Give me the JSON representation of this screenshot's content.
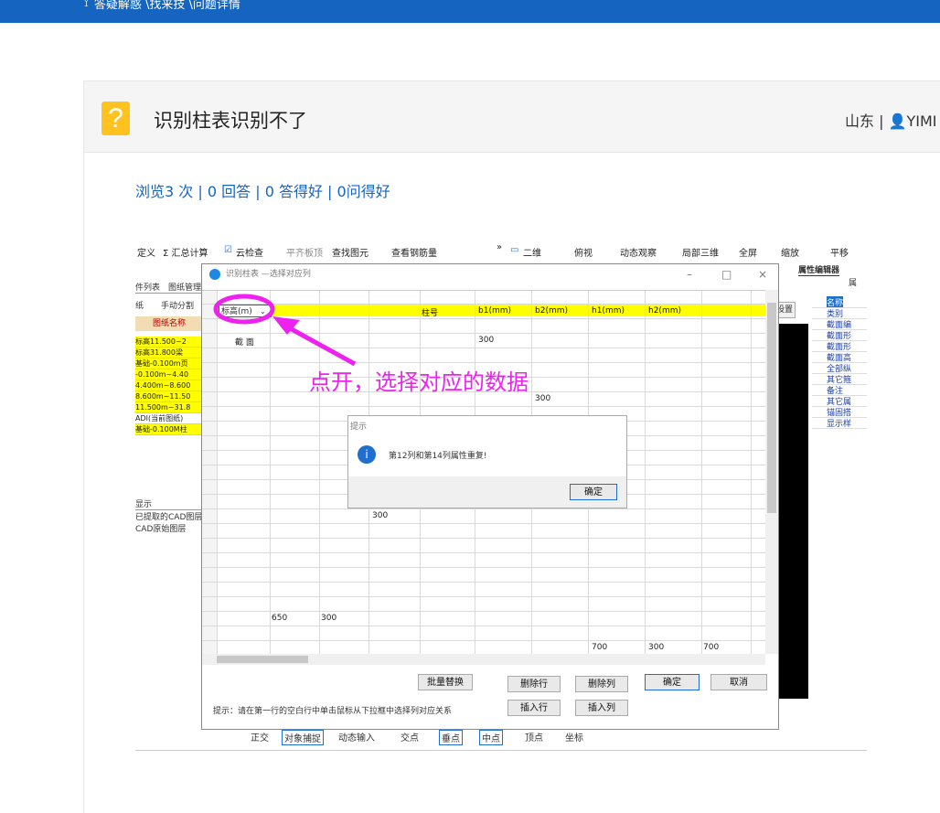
{
  "topbar": {
    "breadcrumb": "答疑解惑 \\找来技 \\问题详情"
  },
  "question": {
    "title": "识别柱表识别不了",
    "region": "山东",
    "user": "YIMI",
    "stats": {
      "views": "浏览3 次",
      "answers": "0 回答",
      "good_answers": "0 答得好",
      "good_questions": "0问得好"
    }
  },
  "screenshot": {
    "toolbar_items": [
      "定义",
      "Σ 汇总计算",
      "云检查",
      "平齐板顶",
      "查找图元",
      "查看钢筋量",
      "二维",
      "俯视",
      "动态观察",
      "局部三维",
      "全屏",
      "缩放",
      "平移"
    ],
    "left_tabs": [
      "件列表",
      "图纸管理"
    ],
    "left_combo": [
      "纸",
      "手动分割"
    ],
    "left_header": "图纸名称",
    "left_rows": [
      "标高11.500~2",
      "标高31.800梁",
      "基础-0.100m页",
      "-0.100m~4.40",
      "4.400m~8.600",
      "8.600m~11.50",
      "11.500m~31.8",
      "ADI(当前图纸)",
      "基础-0.100M柱"
    ],
    "left_display": {
      "title": "显示",
      "items": [
        "已提取的CAD图层",
        "CAD原始图层"
      ]
    },
    "dialog": {
      "title": "识别柱表 —选择对应列",
      "col_headers": [
        "标高(m)",
        "",
        "",
        "柱号",
        "b1(mm)",
        "b2(mm)",
        "h1(mm)",
        "h2(mm)"
      ],
      "row1_label": "截 面",
      "values": [
        "300",
        "300",
        "300",
        "650",
        "300",
        "700",
        "300",
        "700"
      ],
      "buttons": [
        "批量替换",
        "删除行",
        "删除列",
        "确定",
        "取消",
        "插入行",
        "插入列"
      ],
      "hint": "提示：请在第一行的空白行中单击鼠标从下拉框中选择列对应关系"
    },
    "alert": {
      "title": "提示",
      "message": "第12列和第14列属性重复!",
      "ok": "确定"
    },
    "annotation": "点开，选择对应的数据",
    "right_panel": {
      "title": "属性编辑器",
      "header": "属",
      "rows": [
        {
          "n": "1",
          "t": "名称"
        },
        {
          "n": "2",
          "t": "类别"
        },
        {
          "n": "3",
          "t": "截面编"
        },
        {
          "n": "4",
          "t": "截面形"
        },
        {
          "n": "5",
          "t": "截面形"
        },
        {
          "n": "6",
          "t": "截面高"
        },
        {
          "n": "7",
          "t": "全部纵"
        },
        {
          "n": "8",
          "t": "其它箍"
        },
        {
          "n": "9",
          "t": "备注"
        },
        {
          "n": "10",
          "t": "其它属"
        },
        {
          "n": "22",
          "t": "锚固搭"
        },
        {
          "n": "37",
          "t": "显示样"
        }
      ],
      "setting": "设置"
    },
    "status_bar": [
      "正交",
      "对象捕捉",
      "动态输入",
      "交点",
      "垂点",
      "中点",
      "顶点",
      "坐标"
    ]
  }
}
